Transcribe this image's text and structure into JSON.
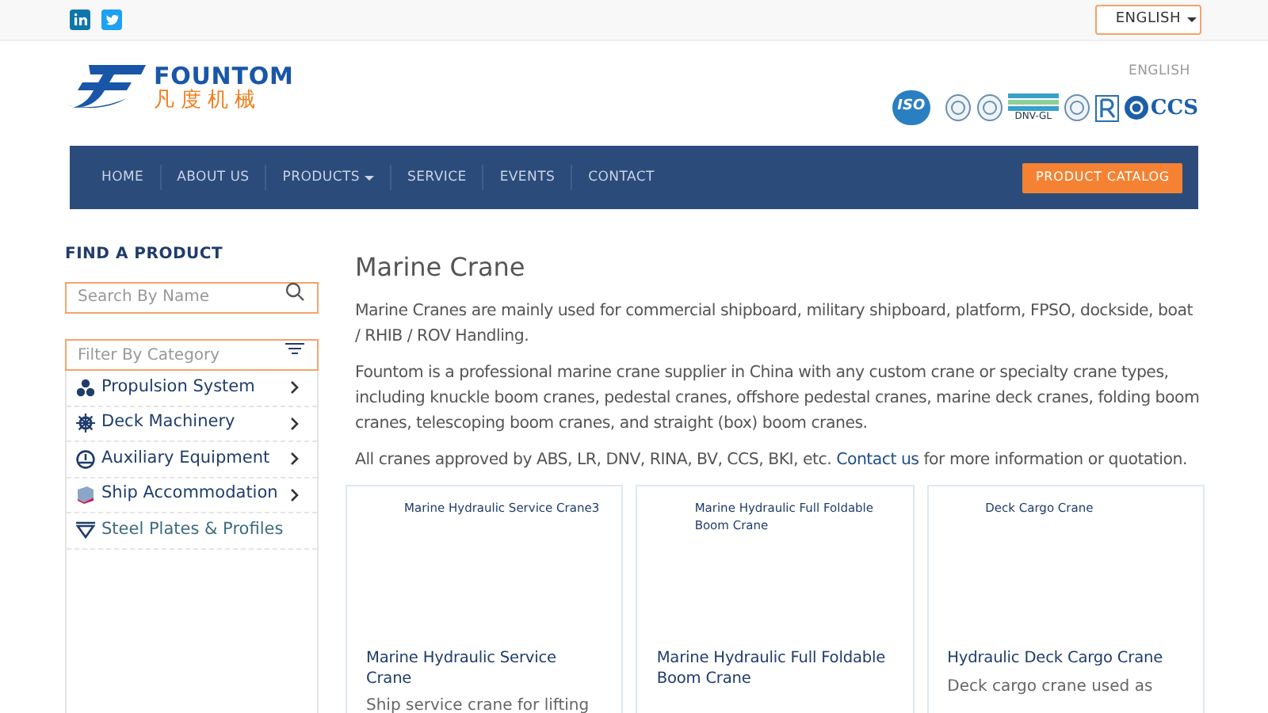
{
  "top_bar": {
    "language_select": "ENGLISH",
    "language_link": "ENGLISH"
  },
  "logo": {
    "wordmark": "FOUNTOM",
    "chinese": "凡度机械"
  },
  "certifications": [
    {
      "kind": "iso",
      "label": "ISO"
    },
    {
      "kind": "seal"
    },
    {
      "kind": "seal"
    },
    {
      "kind": "dnv",
      "label": "DNV-GL"
    },
    {
      "kind": "seal"
    },
    {
      "kind": "r"
    },
    {
      "kind": "ccs",
      "label": "CCS"
    }
  ],
  "nav": {
    "items": [
      {
        "label": "HOME",
        "dropdown": false
      },
      {
        "label": "ABOUT US",
        "dropdown": false
      },
      {
        "label": "PRODUCTS",
        "dropdown": true
      },
      {
        "label": "SERVICE",
        "dropdown": false
      },
      {
        "label": "EVENTS",
        "dropdown": false
      },
      {
        "label": "CONTACT",
        "dropdown": false
      }
    ],
    "catalog_button": "PRODUCT CATALOG"
  },
  "sidebar": {
    "title": "FIND A PRODUCT",
    "search": {
      "placeholder": "Search By Name"
    },
    "filter": {
      "placeholder": "Filter By Category"
    },
    "categories": [
      {
        "label": "Propulsion System",
        "kind": "propeller",
        "has_children": true
      },
      {
        "label": "Deck Machinery",
        "kind": "wheel",
        "has_children": true
      },
      {
        "label": "Auxiliary Equipment",
        "kind": "gauge",
        "has_children": true
      },
      {
        "label": "Ship Accommodation",
        "kind": "cabin",
        "has_children": true
      },
      {
        "label": "Steel Plates & Profiles",
        "kind": "plate",
        "has_children": false
      }
    ]
  },
  "content": {
    "title": "Marine Crane",
    "paragraphs": [
      {
        "text": "Marine Cranes are mainly used for commercial shipboard, military shipboard, platform, FPSO, dockside, boat / RHIB / ROV Handling."
      },
      {
        "text": "Fountom is a professional marine crane supplier in China with any custom crane or specialty crane types, including knuckle boom cranes, pedestal cranes, offshore pedestal cranes, marine deck cranes, folding boom cranes, telescoping boom cranes, and straight (box) boom cranes."
      },
      {
        "text": "All cranes approved by ABS, LR, DNV, RINA, BV, CCS, BKI, etc.",
        "link": "Contact us",
        "after": "for more information or quotation."
      }
    ],
    "cards": [
      {
        "image_alt": "Marine Hydraulic Service Crane3",
        "title": "Marine Hydraulic Service Crane",
        "description": "Ship service crane for lifting"
      },
      {
        "image_alt": "Marine Hydraulic Full Foldable Boom Crane",
        "title": "Marine Hydraulic Full Foldable Boom Crane"
      },
      {
        "image_alt": "Deck Cargo Crane",
        "title": "Hydraulic Deck Cargo Crane",
        "description": "Deck cargo crane used as"
      }
    ]
  }
}
